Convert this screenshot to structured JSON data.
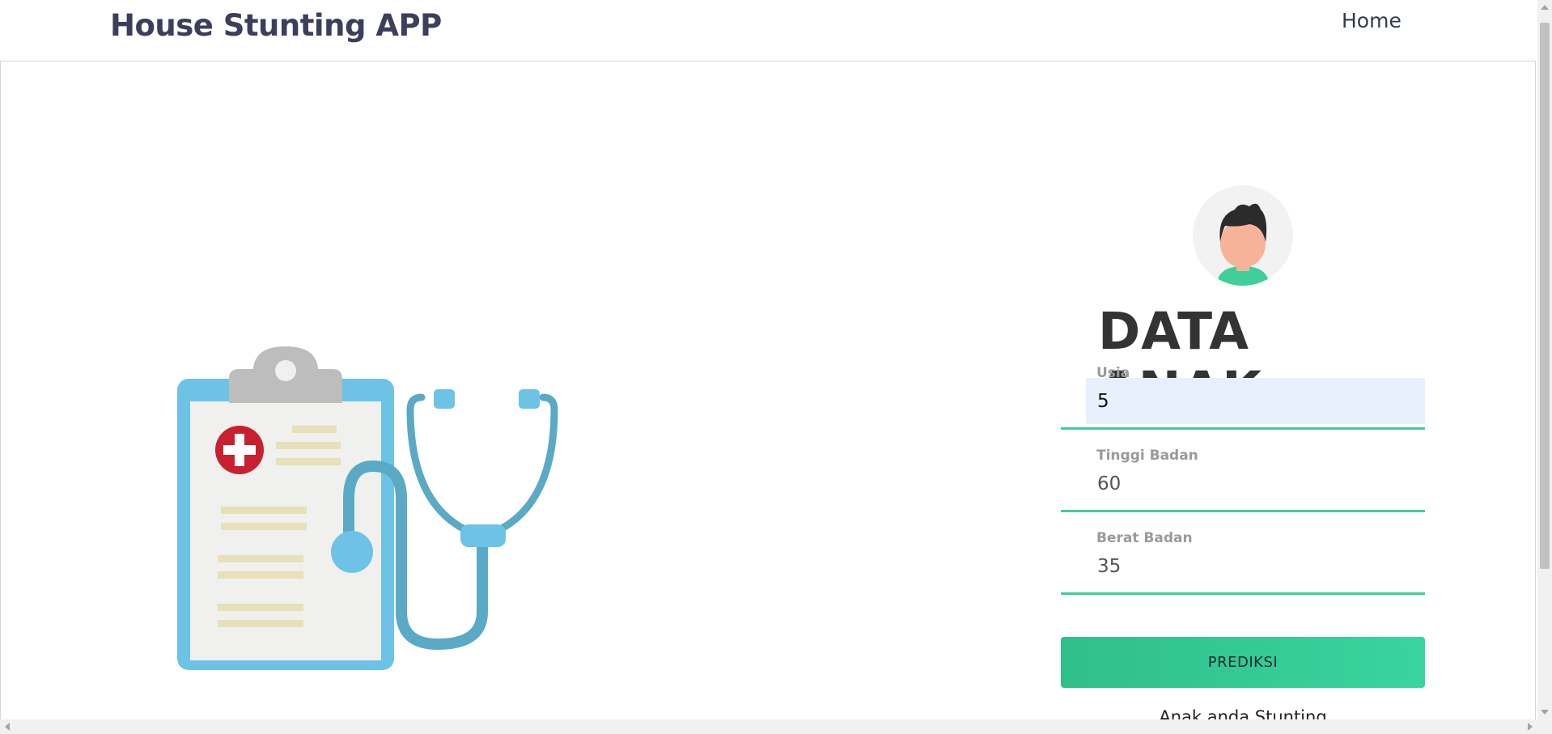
{
  "navbar": {
    "brand": "House Stunting APP",
    "links": [
      {
        "label": "Home"
      }
    ]
  },
  "form": {
    "title": "DATA ANAK",
    "fields": [
      {
        "label": "Usia",
        "value": "5"
      },
      {
        "label": "Tinggi Badan",
        "value": "60"
      },
      {
        "label": "Berat Badan",
        "value": "35"
      }
    ],
    "submit_label": "PREDIKSI",
    "result_text": "Anak anda Stunting"
  },
  "colors": {
    "accent": "#3ecf9b",
    "brand_text": "#3b3f5c",
    "autofill_bg": "#e8f0fe"
  },
  "icons": {
    "illustration": "clipboard-stethoscope-icon",
    "avatar": "child-avatar-icon"
  }
}
